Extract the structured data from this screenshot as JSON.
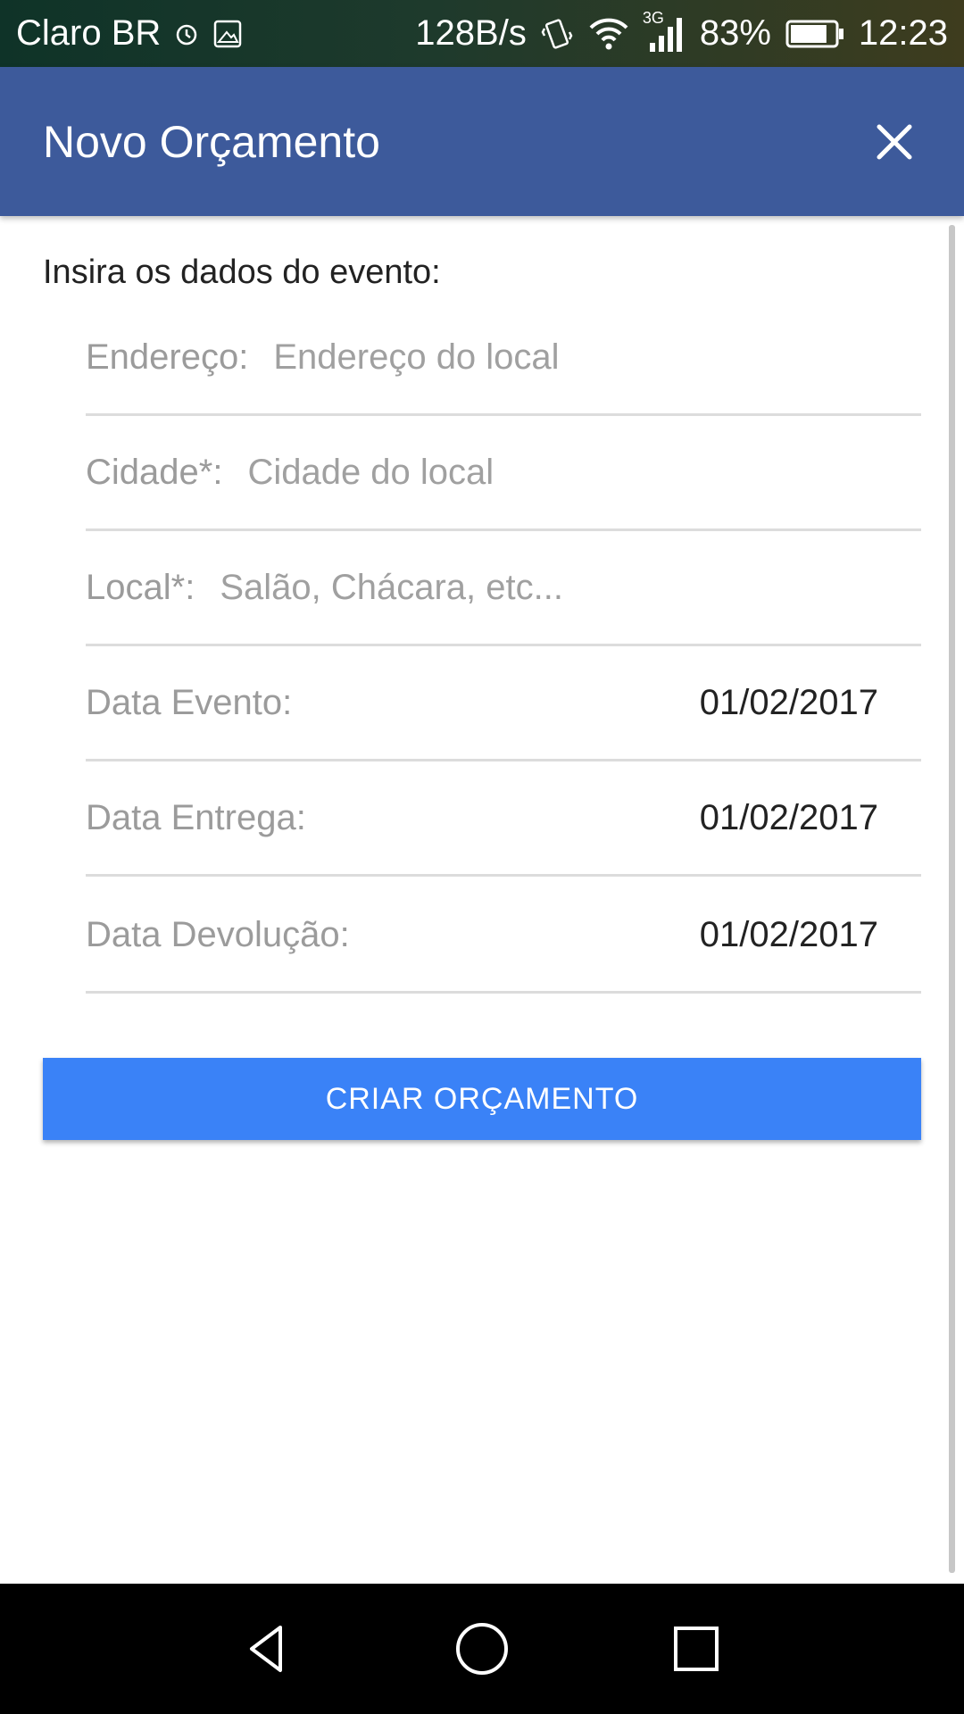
{
  "status_bar": {
    "carrier": "Claro BR",
    "alarm_icon": "alarm-icon",
    "gallery_icon": "image-icon",
    "network_speed": "128B/s",
    "vibrate_icon": "vibrate-icon",
    "wifi_icon": "wifi-icon",
    "network_type": "3G",
    "signal_icon": "signal-icon",
    "battery_percent": "83%",
    "battery_level": 0.83,
    "time": "12:23"
  },
  "app_bar": {
    "title": "Novo Orçamento",
    "close_icon": "close-icon",
    "background_color": "#3d5a9b"
  },
  "form": {
    "intro": "Insira os dados do evento:",
    "endereco": {
      "label": "Endereço:",
      "placeholder": "Endereço do local",
      "value": ""
    },
    "cidade": {
      "label": "Cidade*:",
      "placeholder": "Cidade do local",
      "value": ""
    },
    "local": {
      "label": "Local*:",
      "placeholder": "Salão, Chácara, etc...",
      "value": ""
    },
    "data_evento": {
      "label": "Data Evento:",
      "value": "01/02/2017"
    },
    "data_entrega": {
      "label": "Data Entrega:",
      "value": "01/02/2017"
    },
    "data_devolucao": {
      "label": "Data Devolução:",
      "value": "01/02/2017"
    },
    "submit_label": "CRIAR ORÇAMENTO",
    "submit_color": "#3a82f7"
  },
  "nav_bar": {
    "back_icon": "back-triangle-icon",
    "home_icon": "home-circle-icon",
    "recents_icon": "recents-square-icon"
  }
}
